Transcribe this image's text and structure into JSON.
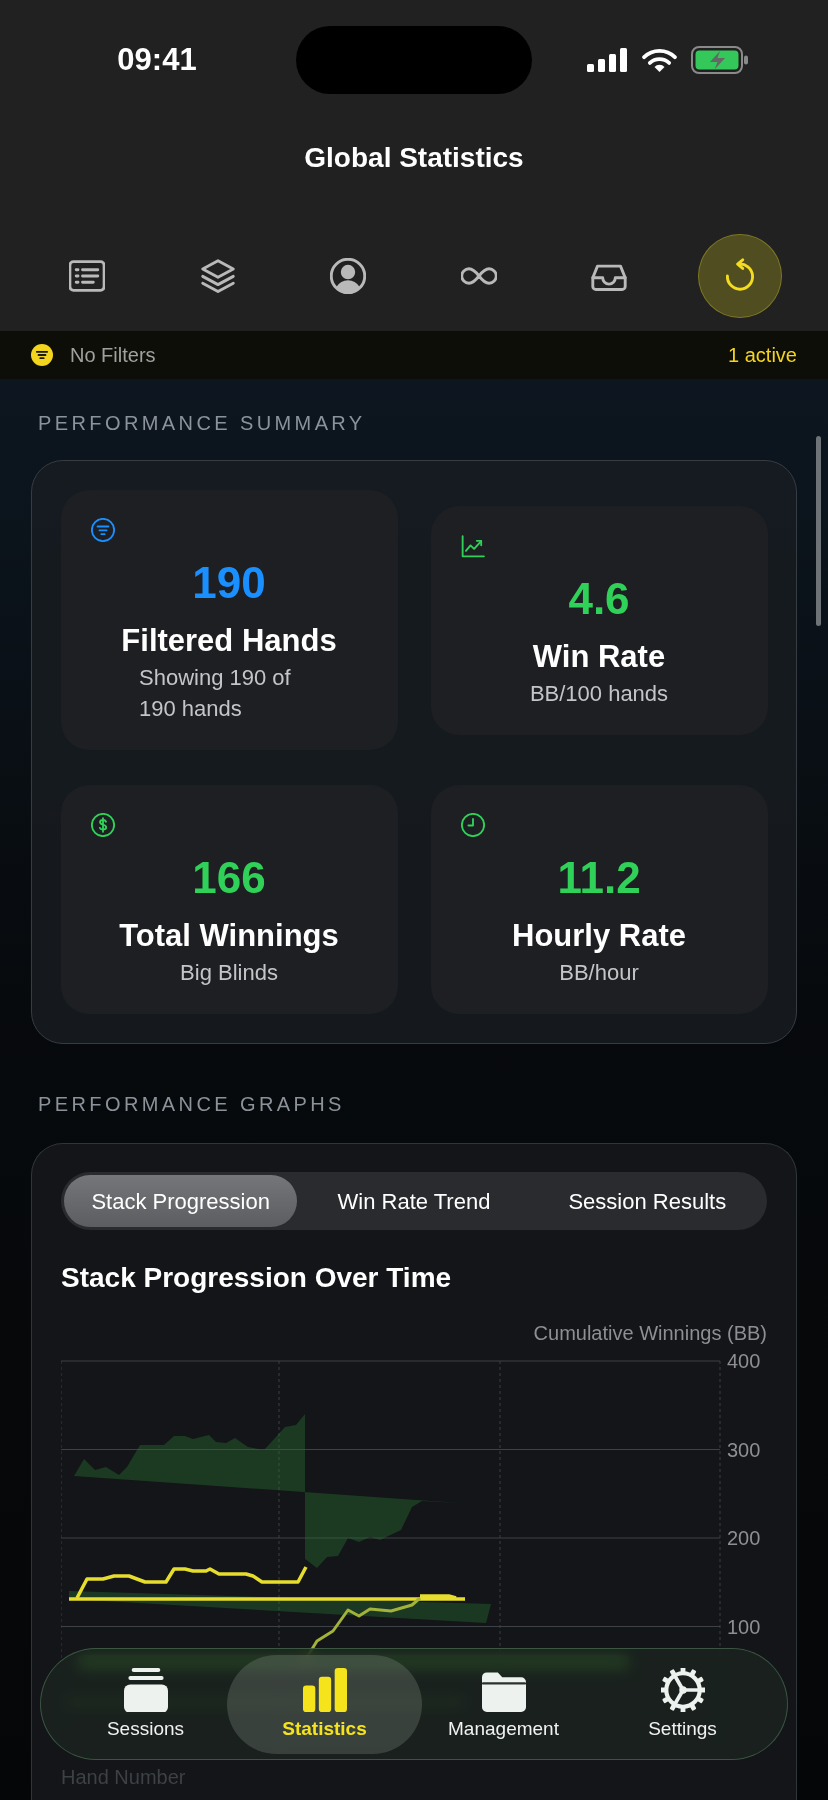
{
  "status_bar": {
    "time": "09:41"
  },
  "header": {
    "title": "Global Statistics"
  },
  "toolbar": [
    {
      "selected": false
    },
    {
      "selected": false
    },
    {
      "selected": false
    },
    {
      "selected": false
    },
    {
      "selected": false
    },
    {
      "selected": true
    }
  ],
  "filter_bar": {
    "label": "No Filters",
    "status": "1 active"
  },
  "performance_summary": {
    "heading": "PERFORMANCE SUMMARY",
    "stats": [
      {
        "value": "190",
        "label": "Filtered Hands",
        "caption": "Showing 190 of 190 hands",
        "color": "#1a8fff"
      },
      {
        "value": "4.6",
        "label": "Win Rate",
        "caption": "BB/100 hands",
        "color": "#30d158"
      },
      {
        "value": "166",
        "label": "Total Winnings",
        "caption": "Big Blinds",
        "color": "#30d158"
      },
      {
        "value": "11.2",
        "label": "Hourly Rate",
        "caption": "BB/hour",
        "color": "#30d158"
      }
    ]
  },
  "performance_graphs": {
    "heading": "PERFORMANCE GRAPHS",
    "tabs": [
      {
        "label": "Stack Progression",
        "selected": true
      },
      {
        "label": "Win Rate Trend",
        "selected": false
      },
      {
        "label": "Session Results",
        "selected": false
      }
    ],
    "chart": {
      "title": "Stack Progression Over Time",
      "y_axis_title": "Cumulative Winnings (BB)",
      "y_ticks": [
        "400",
        "300",
        "200",
        "100"
      ],
      "x_axis_title": "Hand Number"
    }
  },
  "tab_bar": [
    {
      "label": "Sessions",
      "selected": false
    },
    {
      "label": "Statistics",
      "selected": true
    },
    {
      "label": "Management",
      "selected": false
    },
    {
      "label": "Settings",
      "selected": false
    }
  ]
}
